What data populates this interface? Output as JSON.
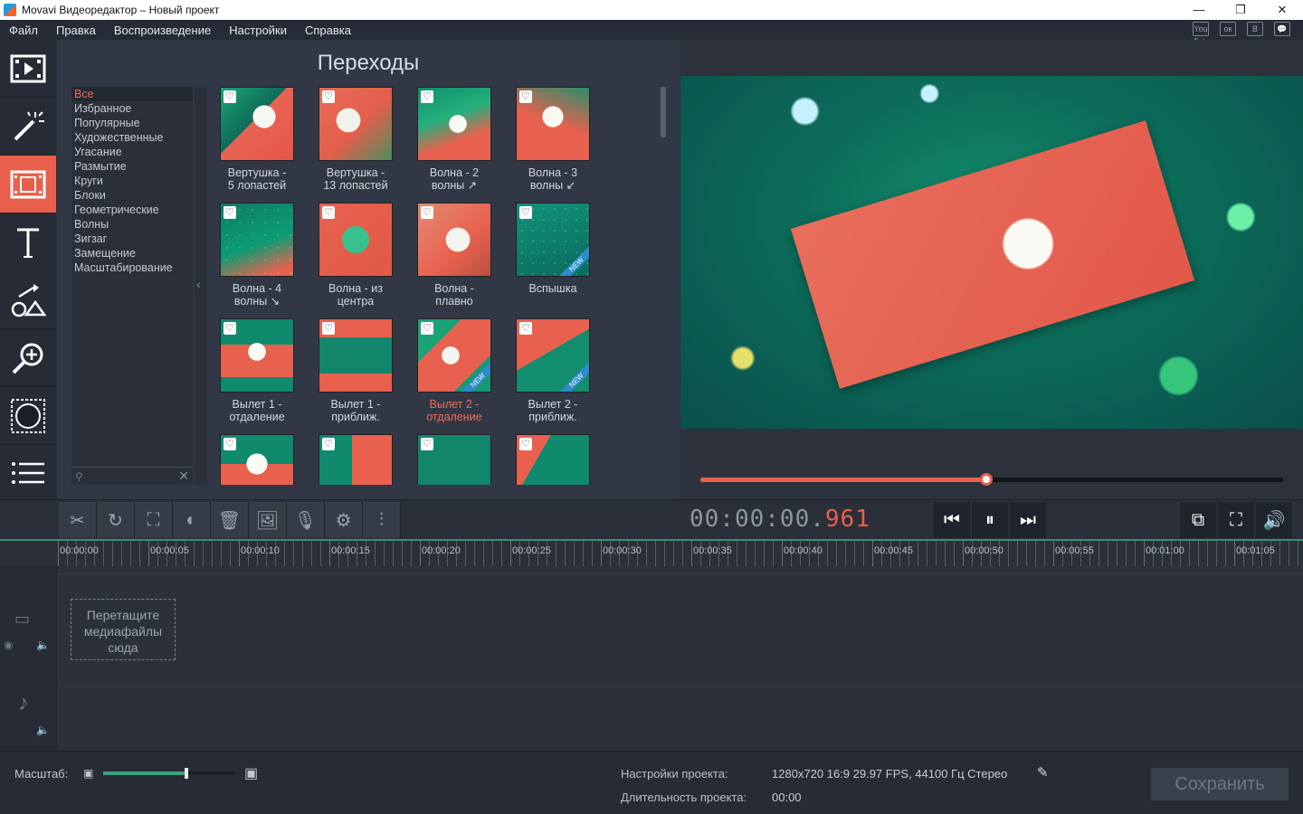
{
  "window": {
    "title": "Movavi Видеоредактор – Новый проект",
    "min": "—",
    "max": "❐",
    "close": "✕"
  },
  "menu": [
    "Файл",
    "Правка",
    "Воспроизведение",
    "Настройки",
    "Справка"
  ],
  "social": [
    "You Tube",
    "ок",
    "В",
    "💬"
  ],
  "nav": [
    {
      "name": "import",
      "active": false
    },
    {
      "name": "filters",
      "active": false
    },
    {
      "name": "transitions",
      "active": true
    },
    {
      "name": "titles",
      "active": false
    },
    {
      "name": "callouts",
      "active": false
    },
    {
      "name": "zoom",
      "active": false
    },
    {
      "name": "chroma",
      "active": false
    },
    {
      "name": "more",
      "active": false
    }
  ],
  "panel": {
    "title": "Переходы",
    "categories": [
      "Все",
      "Избранное",
      "Популярные",
      "Художественные",
      "Угасание",
      "Размытие",
      "Круги",
      "Блоки",
      "Геометрические",
      "Волны",
      "Зигзаг",
      "Замещение",
      "Масштабирование"
    ],
    "active_category": 0,
    "transitions": [
      {
        "l1": "Вертушка -",
        "l2": "5 лопастей",
        "new": false,
        "sel": false
      },
      {
        "l1": "Вертушка -",
        "l2": "13 лопастей",
        "new": false,
        "sel": false
      },
      {
        "l1": "Волна - 2",
        "l2": "волны ↗",
        "new": false,
        "sel": false
      },
      {
        "l1": "Волна - 3",
        "l2": "волны ↙",
        "new": false,
        "sel": false
      },
      {
        "l1": "Волна - 4",
        "l2": "волны ↘",
        "new": false,
        "sel": false
      },
      {
        "l1": "Волна - из",
        "l2": "центра",
        "new": false,
        "sel": false
      },
      {
        "l1": "Волна -",
        "l2": "плавно",
        "new": false,
        "sel": false
      },
      {
        "l1": "Вспышка",
        "l2": "",
        "new": true,
        "sel": false
      },
      {
        "l1": "Вылет 1 -",
        "l2": "отдаление",
        "new": false,
        "sel": false
      },
      {
        "l1": "Вылет 1 -",
        "l2": "приближ.",
        "new": false,
        "sel": false
      },
      {
        "l1": "Вылет 2 -",
        "l2": "отдаление",
        "new": true,
        "sel": true
      },
      {
        "l1": "Вылет 2 -",
        "l2": "приближ.",
        "new": true,
        "sel": false
      },
      {
        "l1": "",
        "l2": "",
        "new": false,
        "sel": false
      },
      {
        "l1": "",
        "l2": "",
        "new": false,
        "sel": false
      },
      {
        "l1": "",
        "l2": "",
        "new": false,
        "sel": false
      },
      {
        "l1": "",
        "l2": "",
        "new": false,
        "sel": false
      }
    ],
    "new_badge": "NEW",
    "heart": "♡"
  },
  "player": {
    "timecode_main": "00:00:00.",
    "timecode_ms": "961",
    "progress": 0.49
  },
  "tools": [
    "✂",
    "↻",
    "⛶",
    "◐",
    "🗑",
    "🖼",
    "🎙",
    "⚙",
    "⫶"
  ],
  "transport": [
    "⏮",
    "⏸",
    "⏭"
  ],
  "view_buttons": [
    "⧉",
    "⛶",
    "🔊"
  ],
  "timeline": {
    "ticks": [
      "00:00:00",
      "00:00:05",
      "00:00:10",
      "00:00:15",
      "00:00:20",
      "00:00:25",
      "00:00:30",
      "00:00:35",
      "00:00:40",
      "00:00:45",
      "00:00:50",
      "00:00:55",
      "00:01:00",
      "00:01:05"
    ],
    "drop_text_1": "Перетащите",
    "drop_text_2": "медиафайлы",
    "drop_text_3": "сюда"
  },
  "status": {
    "scale_label": "Масштаб:",
    "scale_value": 0.63,
    "project_settings_label": "Настройки проекта:",
    "project_settings_value": "1280x720 16:9 29.97 FPS, 44100 Гц Стерео",
    "duration_label": "Длительность проекта:",
    "duration_value": "00:00",
    "save_label": "Сохранить"
  }
}
